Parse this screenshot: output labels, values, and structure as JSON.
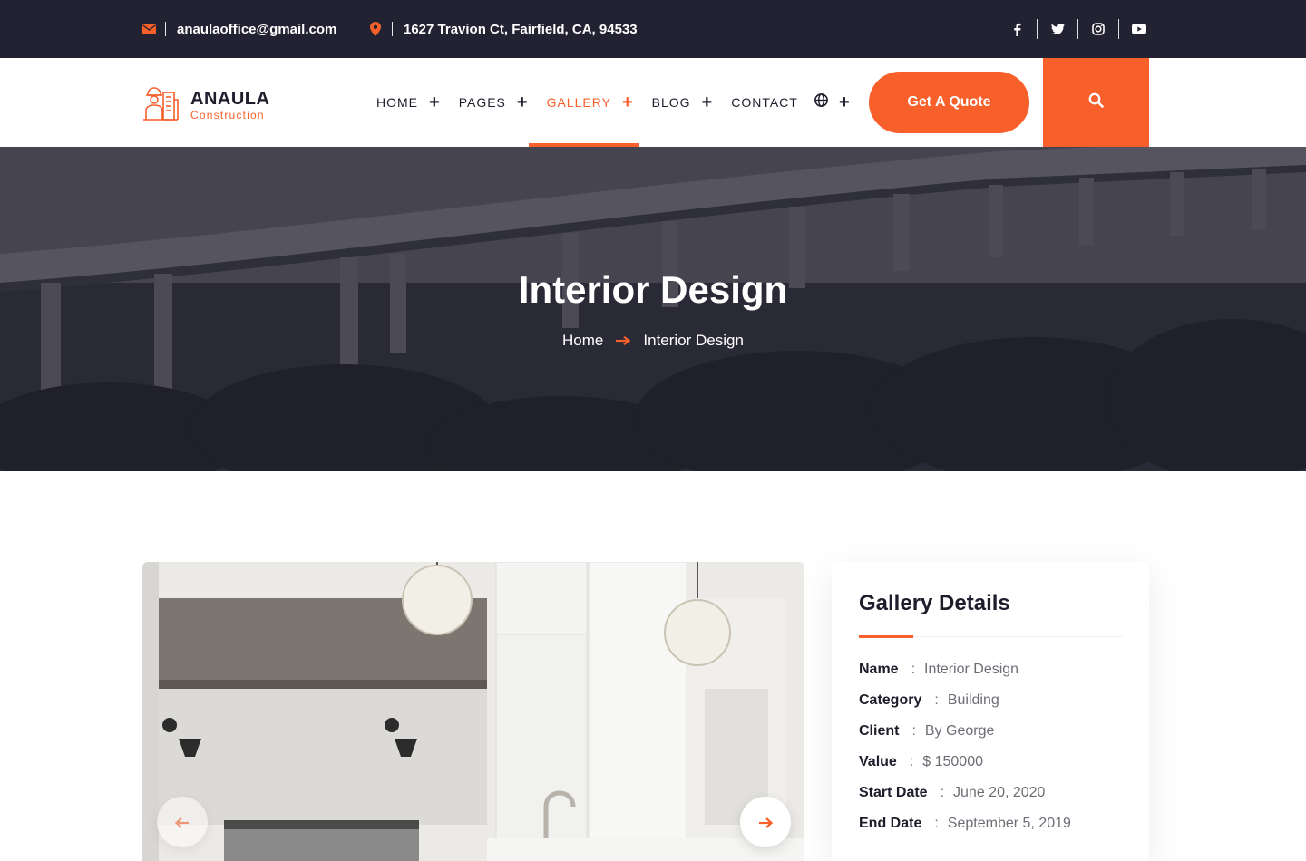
{
  "topbar": {
    "email": "anaulaoffice@gmail.com",
    "address": "1627 Travion Ct, Fairfield, CA, 94533",
    "socials": [
      "facebook-icon",
      "twitter-icon",
      "instagram-icon",
      "youtube-icon"
    ]
  },
  "brand": {
    "name": "ANAULA",
    "tagline": "Construction"
  },
  "nav": {
    "items": [
      {
        "label": "HOME",
        "has_dropdown": true,
        "active": false
      },
      {
        "label": "PAGES",
        "has_dropdown": true,
        "active": false
      },
      {
        "label": "GALLERY",
        "has_dropdown": true,
        "active": true
      },
      {
        "label": "BLOG",
        "has_dropdown": true,
        "active": false
      },
      {
        "label": "CONTACT",
        "has_dropdown": false,
        "active": false
      }
    ],
    "quote_button": "Get A Quote"
  },
  "hero": {
    "title": "Interior Design",
    "breadcrumb": [
      "Home",
      "Interior Design"
    ]
  },
  "gallery_details": {
    "title": "Gallery Details",
    "rows": [
      {
        "key": "Name",
        "value": "Interior Design"
      },
      {
        "key": "Category",
        "value": "Building"
      },
      {
        "key": "Client",
        "value": "By George"
      },
      {
        "key": "Value",
        "value": "$ 150000"
      },
      {
        "key": "Start Date",
        "value": "June 20, 2020"
      },
      {
        "key": "End Date",
        "value": "September 5, 2019"
      }
    ]
  },
  "colors": {
    "accent": "#f75f2b",
    "dark": "#222232",
    "text": "#1d1d2c"
  }
}
